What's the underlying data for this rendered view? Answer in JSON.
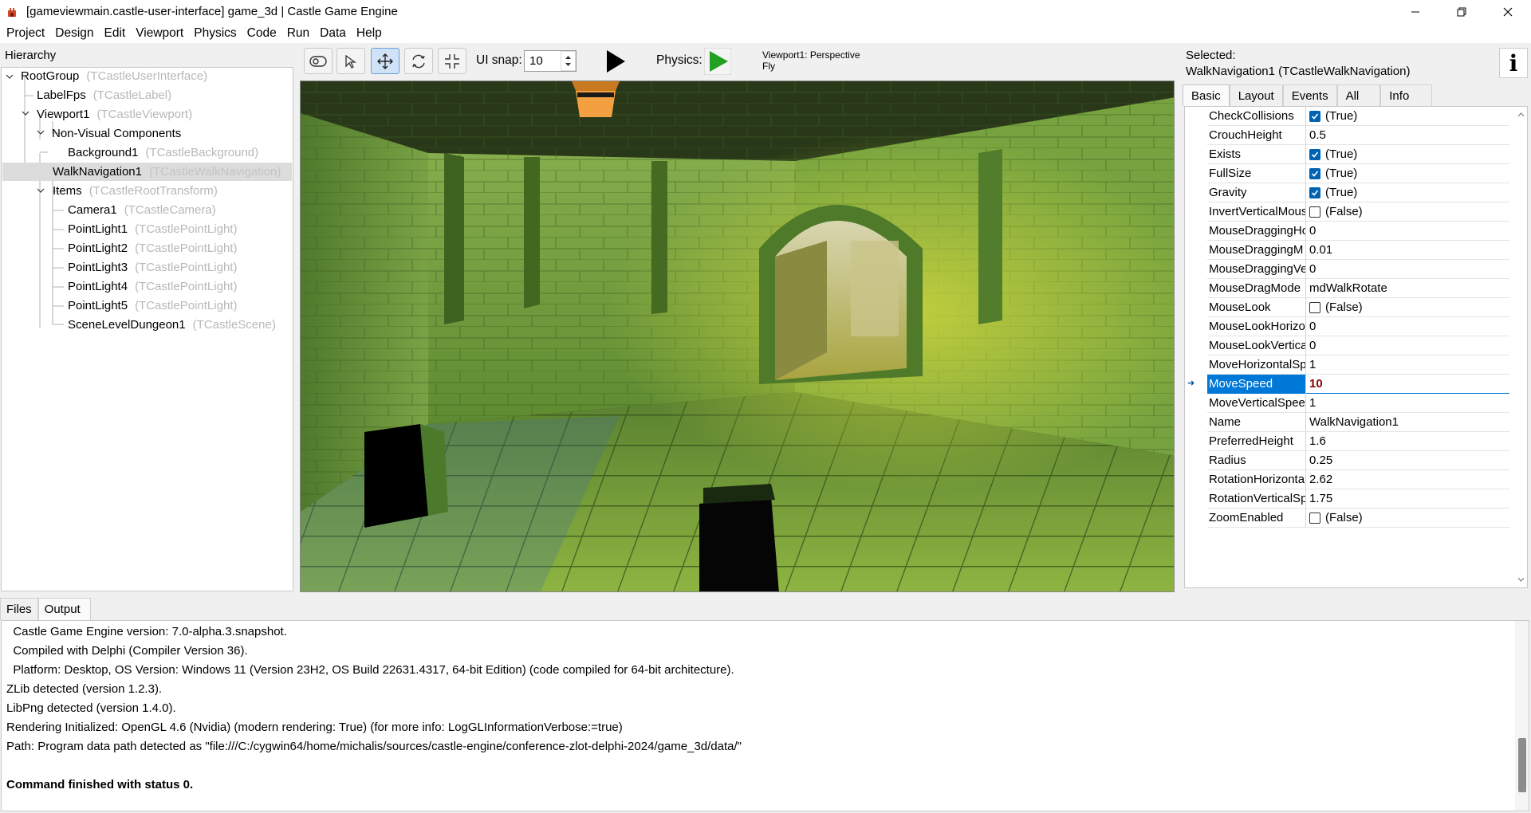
{
  "window": {
    "title": "[gameviewmain.castle-user-interface] game_3d | Castle Game Engine",
    "icons": [
      "app-icon",
      "minimize-icon",
      "restore-icon",
      "close-icon"
    ]
  },
  "menu": [
    "Project",
    "Design",
    "Edit",
    "Viewport",
    "Physics",
    "Code",
    "Run",
    "Data",
    "Help"
  ],
  "hierarchy": {
    "title": "Hierarchy",
    "items": [
      {
        "name": "RootGroup",
        "cls": "(TCastleUserInterface)"
      },
      {
        "name": "LabelFps",
        "cls": "(TCastleLabel)"
      },
      {
        "name": "Viewport1",
        "cls": "(TCastleViewport)"
      },
      {
        "name": "Non-Visual Components",
        "cls": ""
      },
      {
        "name": "Background1",
        "cls": "(TCastleBackground)"
      },
      {
        "name": "WalkNavigation1",
        "cls": "(TCastleWalkNavigation)"
      },
      {
        "name": "Items",
        "cls": "(TCastleRootTransform)"
      },
      {
        "name": "Camera1",
        "cls": "(TCastleCamera)"
      },
      {
        "name": "PointLight1",
        "cls": "(TCastlePointLight)"
      },
      {
        "name": "PointLight2",
        "cls": "(TCastlePointLight)"
      },
      {
        "name": "PointLight3",
        "cls": "(TCastlePointLight)"
      },
      {
        "name": "PointLight4",
        "cls": "(TCastlePointLight)"
      },
      {
        "name": "PointLight5",
        "cls": "(TCastlePointLight)"
      },
      {
        "name": "SceneLevelDungeon1",
        "cls": "(TCastleScene)"
      }
    ]
  },
  "toolbar": {
    "snap_label": "UI snap:",
    "snap_value": "10",
    "physics_label": "Physics:",
    "viewport_line1": "Viewport1: Perspective",
    "viewport_line2": "Fly",
    "icons": [
      "interact-icon",
      "select-icon",
      "translate-icon",
      "rotate-icon",
      "scale-icon",
      "play-icon",
      "physics-play-icon"
    ]
  },
  "inspector": {
    "selected_label": "Selected:",
    "selected_value": "WalkNavigation1 (TCastleWalkNavigation)",
    "info_glyph": "i",
    "tabs": [
      "Basic",
      "Layout",
      "Events",
      "All",
      "Info"
    ],
    "active_tab": "Basic",
    "selected_marker": "➜",
    "properties": [
      {
        "name": "CheckCollisions",
        "value": "(True)",
        "checkbox": true
      },
      {
        "name": "CrouchHeight",
        "value": "0.5"
      },
      {
        "name": "Exists",
        "value": "(True)",
        "checkbox": true
      },
      {
        "name": "FullSize",
        "value": "(True)",
        "checkbox": true
      },
      {
        "name": "Gravity",
        "value": "(True)",
        "checkbox": true
      },
      {
        "name": "InvertVerticalMous",
        "value": "(False)",
        "checkbox": false
      },
      {
        "name": "MouseDraggingHo",
        "value": "0"
      },
      {
        "name": "MouseDraggingM",
        "value": "0.01"
      },
      {
        "name": "MouseDraggingVe",
        "value": "0"
      },
      {
        "name": "MouseDragMode",
        "value": "mdWalkRotate"
      },
      {
        "name": "MouseLook",
        "value": "(False)",
        "checkbox": false
      },
      {
        "name": "MouseLookHorizo",
        "value": "0"
      },
      {
        "name": "MouseLookVertica",
        "value": "0"
      },
      {
        "name": "MoveHorizontalSp",
        "value": "1"
      },
      {
        "name": "MoveSpeed",
        "value": "10",
        "selected": true
      },
      {
        "name": "MoveVerticalSpee",
        "value": "1"
      },
      {
        "name": "Name",
        "value": "WalkNavigation1"
      },
      {
        "name": "PreferredHeight",
        "value": "1.6"
      },
      {
        "name": "Radius",
        "value": "0.25"
      },
      {
        "name": "RotationHorizonta",
        "value": "2.62"
      },
      {
        "name": "RotationVerticalSp",
        "value": "1.75"
      },
      {
        "name": "ZoomEnabled",
        "value": "(False)",
        "checkbox": false
      }
    ]
  },
  "bottom": {
    "tabs": [
      "Files",
      "Output"
    ],
    "active_tab": "Output",
    "lines": [
      "  Castle Game Engine version: 7.0-alpha.3.snapshot.",
      "  Compiled with Delphi (Compiler Version 36).",
      "  Platform: Desktop, OS Version: Windows 11 (Version 23H2, OS Build 22631.4317, 64-bit Edition) (code compiled for 64-bit architecture).",
      "ZLib detected (version 1.2.3).",
      "LibPng detected (version 1.4.0).",
      "Rendering Initialized: OpenGL 4.6 (Nvidia) (modern rendering: True) (for more info: LogGLInformationVerbose:=true)",
      "Path: Program data path detected as \"file:///C:/cygwin64/home/michalis/sources/castle-engine/conference-zlot-delphi-2024/game_3d/data/\"",
      "",
      "Command finished with status 0."
    ]
  },
  "colors": {
    "accent": "#0078d7",
    "play_black": "#000000",
    "play_green": "#22a022",
    "checkbox": "#0063b1",
    "dungeon_green": "#6a9a3a"
  }
}
